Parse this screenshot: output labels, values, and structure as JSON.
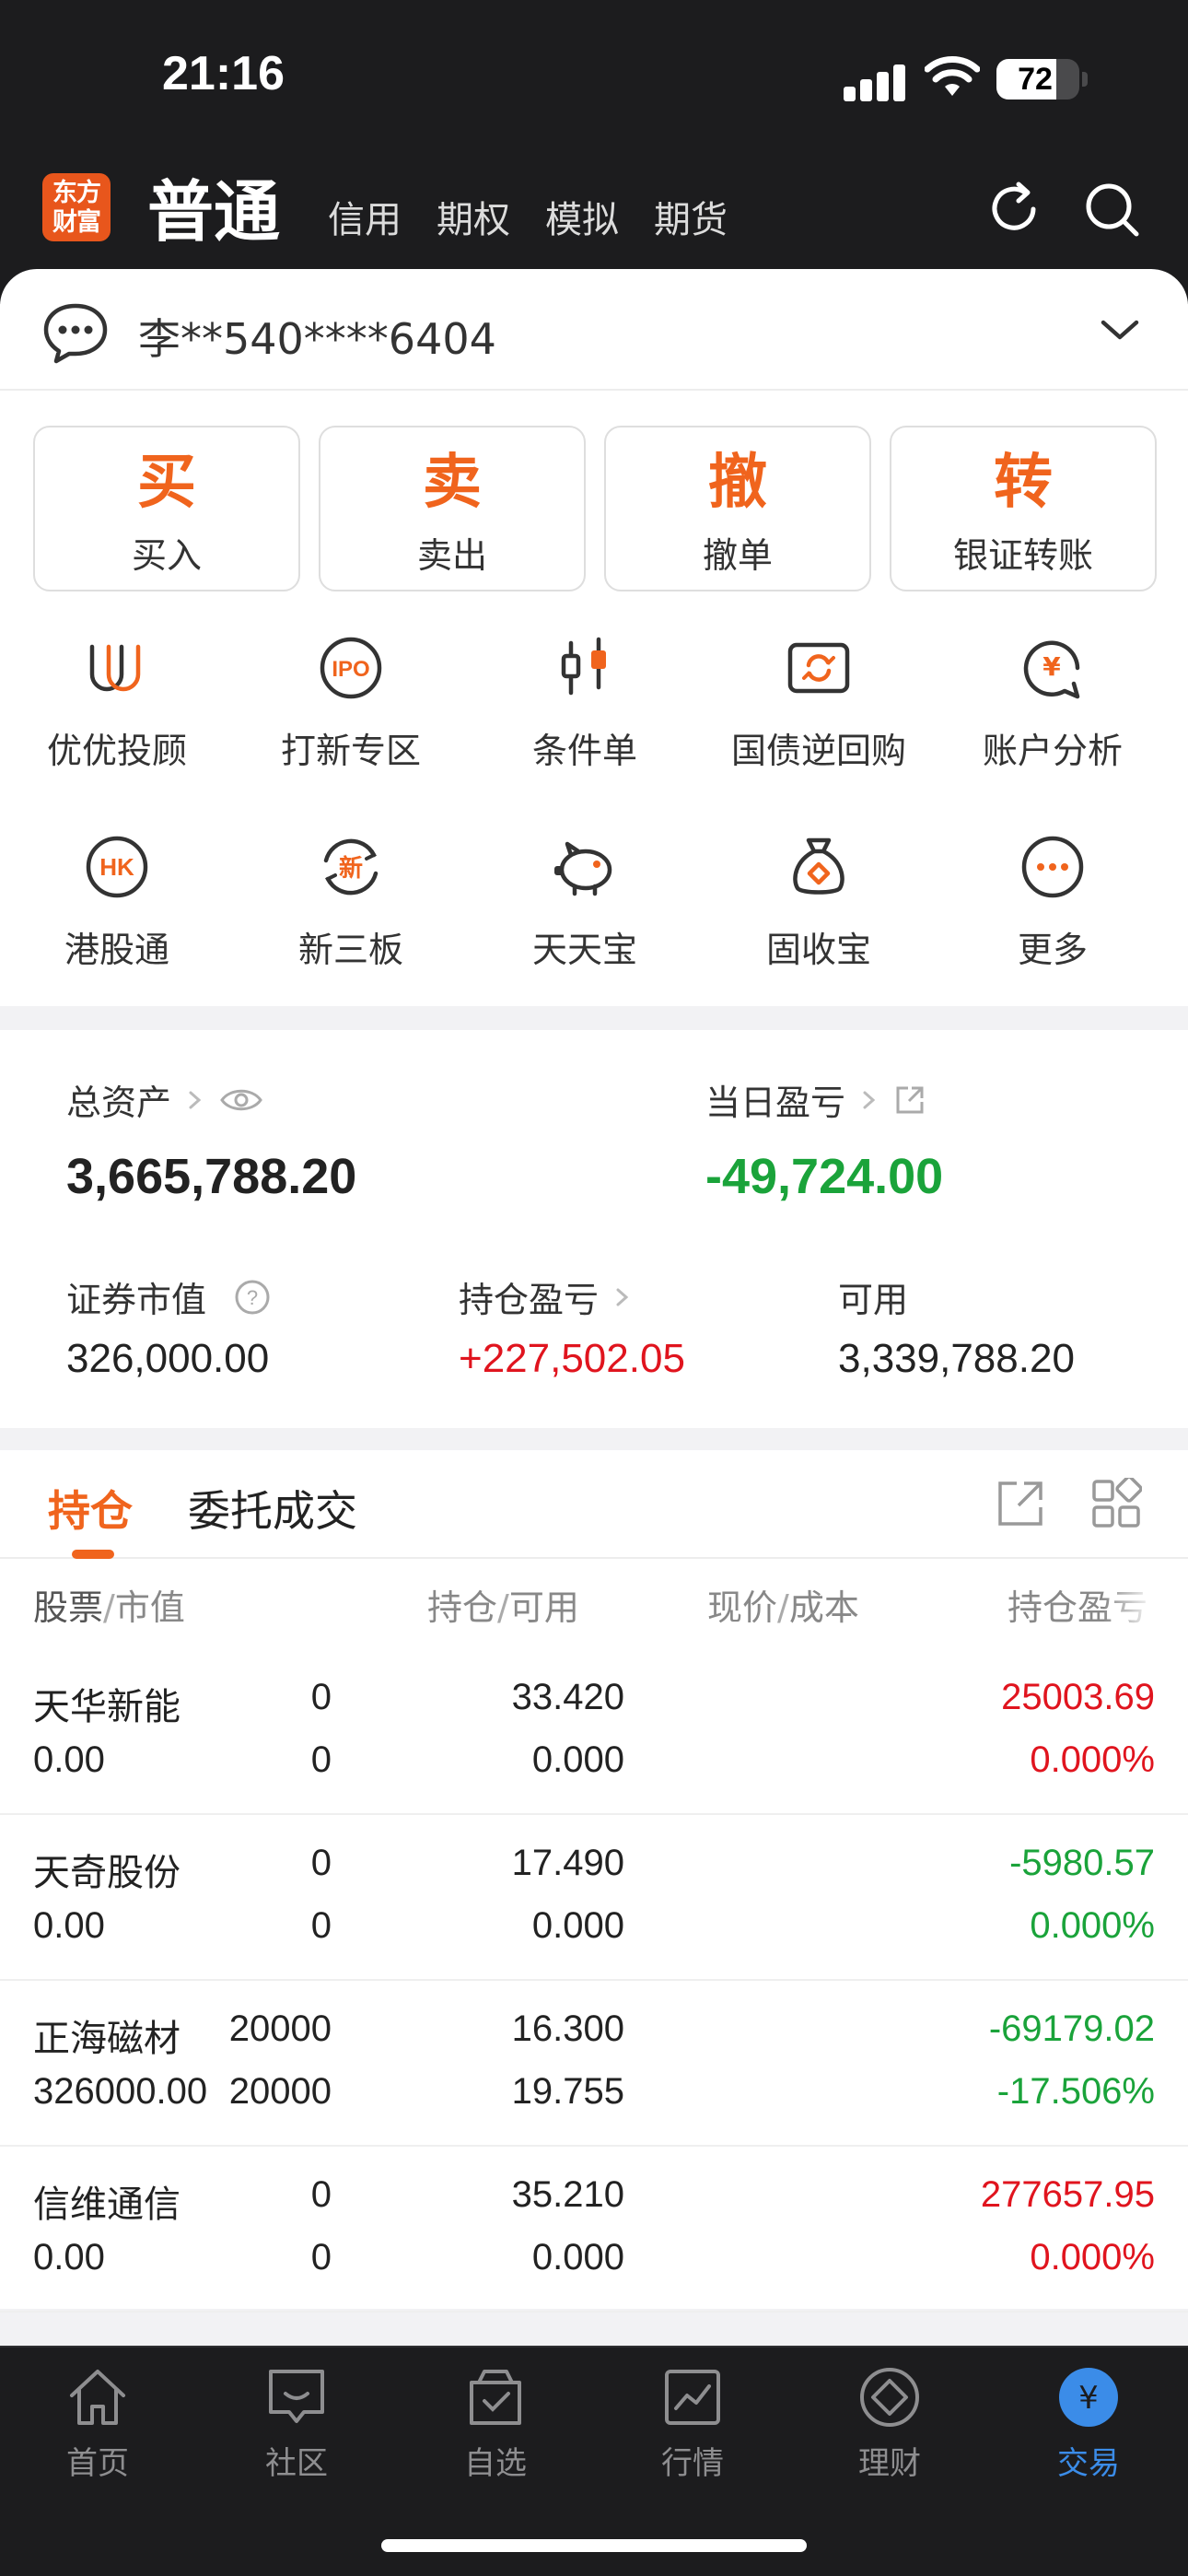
{
  "status_bar": {
    "time": "21:16",
    "battery_level": 72,
    "battery": "72"
  },
  "header": {
    "logo_text": "东方财富",
    "tabs": [
      {
        "label": "普通",
        "active": true
      },
      {
        "label": "信用"
      },
      {
        "label": "期权"
      },
      {
        "label": "模拟"
      },
      {
        "label": "期货"
      }
    ],
    "icons": [
      "refresh-icon",
      "search-icon"
    ]
  },
  "account": {
    "name": "李**540****6404"
  },
  "actions": [
    {
      "char": "买",
      "label": "买入"
    },
    {
      "char": "卖",
      "label": "卖出"
    },
    {
      "char": "撤",
      "label": "撤单"
    },
    {
      "char": "转",
      "label": "银证转账"
    }
  ],
  "services": [
    {
      "label": "优优投顾",
      "icon": "advisor-icon"
    },
    {
      "label": "打新专区",
      "icon": "ipo-icon"
    },
    {
      "label": "条件单",
      "icon": "candlestick-icon"
    },
    {
      "label": "国债逆回购",
      "icon": "repo-icon"
    },
    {
      "label": "账户分析",
      "icon": "analysis-icon"
    },
    {
      "label": "港股通",
      "icon": "hk-icon"
    },
    {
      "label": "新三板",
      "icon": "new-board-icon"
    },
    {
      "label": "天天宝",
      "icon": "piggy-bank-icon"
    },
    {
      "label": "固收宝",
      "icon": "money-bag-icon"
    },
    {
      "label": "更多",
      "icon": "more-icon"
    }
  ],
  "assets": {
    "total_label": "总资产",
    "total_value": "3,665,788.20",
    "daily_label": "当日盈亏",
    "daily_value": "-49,724.00",
    "market_label": "证券市值",
    "market_value": "326,000.00",
    "position_label": "持仓盈亏",
    "position_value": "+227,502.05",
    "available_label": "可用",
    "available_value": "3,339,788.20"
  },
  "holdings": {
    "tabs": [
      "持仓",
      "委托成交"
    ],
    "columns": {
      "c1a": "股票",
      "c1b": "市值",
      "c2a": "持仓",
      "c2b": "可用",
      "c3a": "现价",
      "c3b": "成本",
      "c4": "持仓盈亏"
    },
    "rows": [
      {
        "name": "天华新能",
        "value": "0.00",
        "pos": "0",
        "avail": "0",
        "price": "33.420",
        "cost": "0.000",
        "pl": "25003.69",
        "pct": "0.000%",
        "pl_color": "red",
        "pct_color": "red"
      },
      {
        "name": "天奇股份",
        "value": "0.00",
        "pos": "0",
        "avail": "0",
        "price": "17.490",
        "cost": "0.000",
        "pl": "-5980.57",
        "pct": "0.000%",
        "pl_color": "green",
        "pct_color": "green"
      },
      {
        "name": "正海磁材",
        "value": "326000.00",
        "pos": "20000",
        "avail": "20000",
        "price": "16.300",
        "cost": "19.755",
        "pl": "-69179.02",
        "pct": "-17.506%",
        "pl_color": "green",
        "pct_color": "green"
      },
      {
        "name": "信维通信",
        "value": "0.00",
        "pos": "0",
        "avail": "0",
        "price": "35.210",
        "cost": "0.000",
        "pl": "277657.95",
        "pct": "0.000%",
        "pl_color": "red",
        "pct_color": "red"
      }
    ]
  },
  "tabbar": [
    {
      "label": "首页",
      "icon": "home-icon"
    },
    {
      "label": "社区",
      "icon": "community-icon"
    },
    {
      "label": "自选",
      "icon": "watchlist-icon"
    },
    {
      "label": "行情",
      "icon": "market-icon"
    },
    {
      "label": "理财",
      "icon": "wealth-icon"
    },
    {
      "label": "交易",
      "icon": "trade-icon",
      "active": true
    }
  ],
  "colors": {
    "accent": "#f0641d",
    "up": "#e0141e",
    "down": "#1aa33a",
    "tab_active": "#3b8ce8"
  }
}
